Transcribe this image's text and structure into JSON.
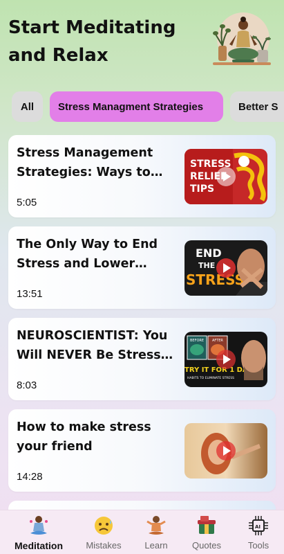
{
  "header": {
    "title": "Start Meditating and Relax"
  },
  "chips": [
    {
      "label": "All",
      "selected": false
    },
    {
      "label": "Stress Managment Strategies",
      "selected": true
    },
    {
      "label": "Better S",
      "selected": false
    }
  ],
  "videos": [
    {
      "title": "Stress Management Strategies: Ways to Unwind",
      "duration": "5:05",
      "thumb_text": "STRESS RELIEF TIPS"
    },
    {
      "title": "The Only Way to End Stress and Lower Cortisol",
      "duration": "13:51",
      "thumb_text": "END THE STRESS"
    },
    {
      "title": "NEUROSCIENTIST: You Will NEVER Be Stressed Again",
      "duration": "8:03",
      "thumb_text": "TRY IT FOR 1 DAY",
      "thumb_sub": "HABITS TO ELIMINATE STRESS",
      "thumb_tag1": "BEFORE",
      "thumb_tag2": "AFTER"
    },
    {
      "title": "How to make stress your friend",
      "duration": "14:28"
    }
  ],
  "bottom_nav": [
    {
      "label": "Meditation",
      "icon": "meditation-icon",
      "active": true
    },
    {
      "label": "Mistakes",
      "icon": "worried-face-icon",
      "active": false
    },
    {
      "label": "Learn",
      "icon": "learn-icon",
      "active": false
    },
    {
      "label": "Quotes",
      "icon": "quotes-icon",
      "active": false
    },
    {
      "label": "Tools",
      "icon": "ai-chip-icon",
      "active": false
    }
  ],
  "colors": {
    "selected_chip": "#e27fe8",
    "chip": "#dcdcdc",
    "play_button": "#e03030"
  }
}
